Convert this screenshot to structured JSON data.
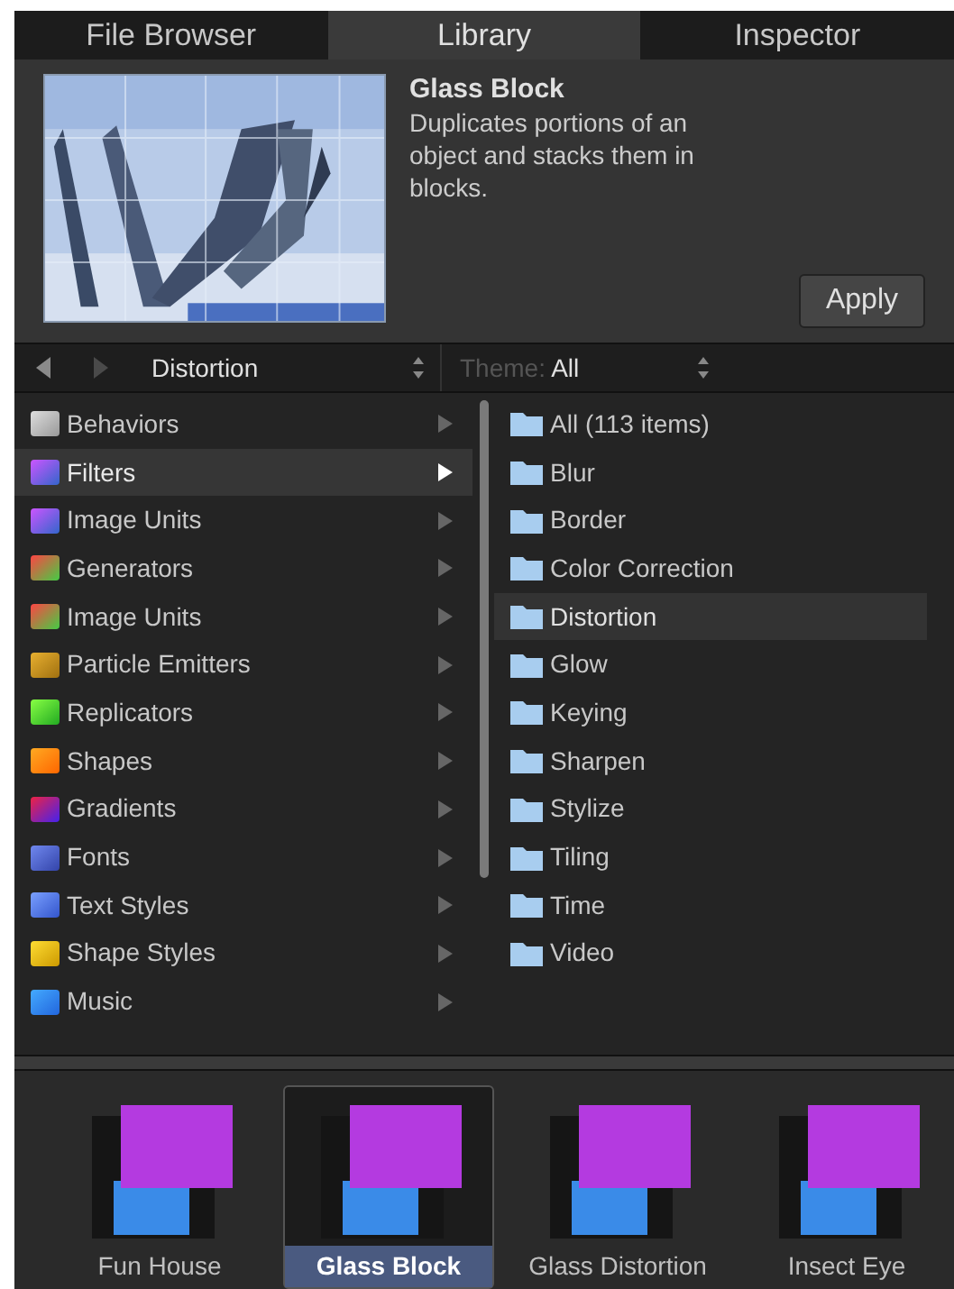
{
  "tabs": [
    {
      "label": "File Browser",
      "selected": false
    },
    {
      "label": "Library",
      "selected": true
    },
    {
      "label": "Inspector",
      "selected": false
    }
  ],
  "preview": {
    "kind": "picture",
    "title": "Glass Block",
    "description": "Duplicates portions of an object and stacks them in blocks.",
    "apply": "Apply"
  },
  "nav": {
    "category": "Distortion",
    "theme_label": "Theme:",
    "theme_value": "All"
  },
  "categories": [
    {
      "label": "Behaviors",
      "selected": false
    },
    {
      "label": "Filters",
      "selected": true
    },
    {
      "label": "Image Units",
      "selected": false
    },
    {
      "label": "Generators",
      "selected": false
    },
    {
      "label": "Image Units",
      "selected": false
    },
    {
      "label": "Particle Emitters",
      "selected": false
    },
    {
      "label": "Replicators",
      "selected": false
    },
    {
      "label": "Shapes",
      "selected": false
    },
    {
      "label": "Gradients",
      "selected": false
    },
    {
      "label": "Fonts",
      "selected": false
    },
    {
      "label": "Text Styles",
      "selected": false
    },
    {
      "label": "Shape Styles",
      "selected": false
    },
    {
      "label": "Music",
      "selected": false
    }
  ],
  "folders": [
    {
      "label": "All (113 items)",
      "selected": false
    },
    {
      "label": "Blur",
      "selected": false
    },
    {
      "label": "Border",
      "selected": false
    },
    {
      "label": "Color Correction",
      "selected": false
    },
    {
      "label": "Distortion",
      "selected": true
    },
    {
      "label": "Glow",
      "selected": false
    },
    {
      "label": "Keying",
      "selected": false
    },
    {
      "label": "Sharpen",
      "selected": false
    },
    {
      "label": "Stylize",
      "selected": false
    },
    {
      "label": "Tiling",
      "selected": false
    },
    {
      "label": "Time",
      "selected": false
    },
    {
      "label": "Video",
      "selected": false
    }
  ],
  "items": [
    {
      "label": "Fun House",
      "selected": false
    },
    {
      "label": "Glass Block",
      "selected": true
    },
    {
      "label": "Glass Distortion",
      "selected": false
    },
    {
      "label": "Insect Eye",
      "selected": false
    }
  ]
}
